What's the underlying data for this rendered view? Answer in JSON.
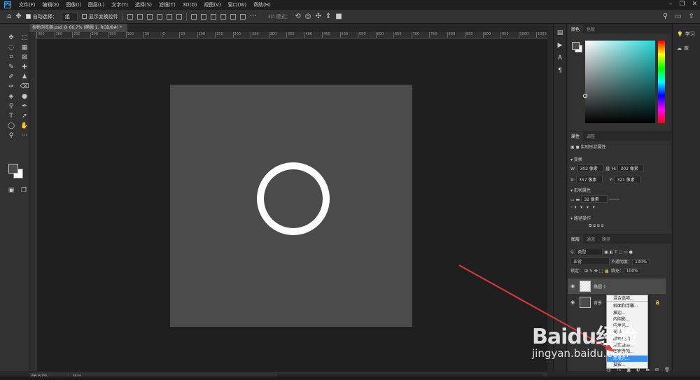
{
  "menubar": {
    "logo": "Ps",
    "items": [
      "文件(F)",
      "编辑(E)",
      "图像(I)",
      "图层(L)",
      "文字(Y)",
      "选择(S)",
      "滤镜(T)",
      "3D(D)",
      "视图(V)",
      "窗口(W)",
      "帮助(H)"
    ],
    "controls": [
      "–",
      "❐",
      "✕"
    ]
  },
  "options": {
    "auto_select_label": "自动选择：",
    "auto_select_value": "组",
    "show_transform_label": "显示变换控件",
    "mode3d_label": "3D 模式："
  },
  "document": {
    "tab_title": "拟物浏览器.psd @ 66.7% (椭圆 1, RGB/8#) *",
    "ruler_ticks": [
      "350",
      "300",
      "250",
      "200",
      "150",
      "100",
      "50",
      "0",
      "50",
      "100",
      "150",
      "200",
      "250",
      "300",
      "350",
      "400",
      "450",
      "500",
      "550",
      "600",
      "650",
      "700",
      "750",
      "800",
      "850",
      "900",
      "950",
      "1000",
      "1050"
    ]
  },
  "status": {
    "zoom": "66.67%",
    "info": "移动"
  },
  "panels": {
    "color_tabs": [
      "颜色",
      "色板"
    ],
    "props_tabs": [
      "属性",
      "调整"
    ],
    "props_title": "实时形状属性",
    "transform_label": "变换",
    "w_label": "W:",
    "w_value": "302 像素",
    "h_label": "H:",
    "h_value": "302 像素",
    "x_label": "X:",
    "x_value": "357 像素",
    "y_label": "Y:",
    "y_value": "321 像素",
    "appearance_label": "形状属性",
    "stroke_value": "32 像素",
    "pathops_label": "路径操作",
    "layers_tabs": [
      "图层",
      "通道",
      "路径"
    ],
    "filter_type": "类型",
    "blend_mode": "正常",
    "opacity_label": "不透明度：",
    "opacity_value": "100%",
    "lock_label": "锁定：",
    "fill_label": "填充：",
    "fill_value": "100%",
    "layer1_name": "椭圆 1",
    "layer2_name": "背景"
  },
  "context_menu": {
    "items": [
      "混合选项...",
      "斜面和浮雕...",
      "描边...",
      "内阴影...",
      "内发光...",
      "光泽...",
      "颜色叠加...",
      "渐变叠加...",
      "图案叠加...",
      "外发光...",
      "投影..."
    ],
    "highlighted_index": 9
  },
  "right_strip": {
    "learn": "学习",
    "library": "库"
  },
  "watermark": {
    "logo": "Baidu经验",
    "url": "jingyan.baidu.com"
  },
  "colors": {
    "accent": "#31a8ff",
    "arrow": "#d93a3a",
    "artboard": "#4a4b4a",
    "highlight": "#3c8ee8"
  }
}
